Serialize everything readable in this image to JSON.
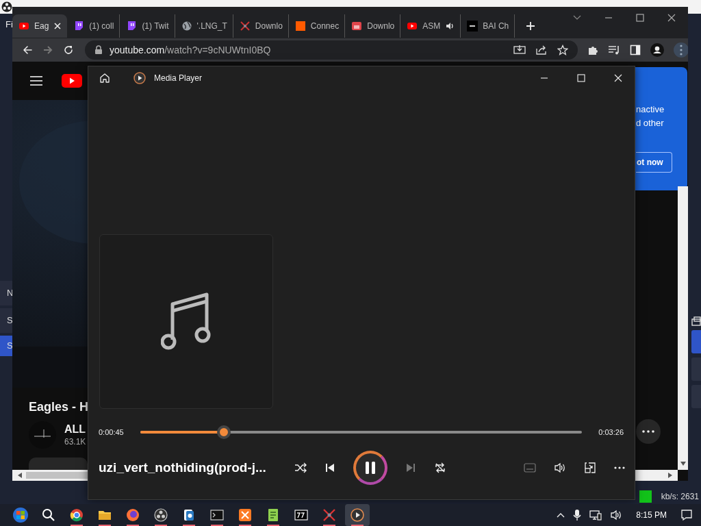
{
  "obs": {
    "menu_text": "Fi",
    "side_texts": [
      "N",
      "S",
      "S"
    ],
    "status_bitrate": "kb/s: 2631"
  },
  "browser": {
    "tabs": [
      {
        "title": "Eag",
        "kind": "youtube",
        "selected": true
      },
      {
        "title": "(1) coll",
        "kind": "twitch",
        "selected": false
      },
      {
        "title": "(1) Twit",
        "kind": "twitch",
        "selected": false
      },
      {
        "title": "'.LNG_T",
        "kind": "globe",
        "selected": false
      },
      {
        "title": "Downlo",
        "kind": "swords",
        "selected": false
      },
      {
        "title": "Connec",
        "kind": "square",
        "selected": false
      },
      {
        "title": "Downlo",
        "kind": "store",
        "selected": false
      },
      {
        "title": "ASM",
        "kind": "youtube",
        "selected": false,
        "audio": true
      },
      {
        "title": "BAI Ch",
        "kind": "bai",
        "selected": false
      }
    ],
    "url_domain": "youtube.com",
    "url_path": "/watch?v=9cNUWtnI0BQ"
  },
  "youtube": {
    "video_title": "Eagles - H",
    "channel": "ALL",
    "subscribers": "63.1K"
  },
  "popup": {
    "lines": [
      "nactive",
      "d other"
    ],
    "button": "ot now"
  },
  "player": {
    "title": "Media Player",
    "elapsed": "0:00:45",
    "total": "0:03:26",
    "level": 0.19,
    "track": "uzi_vert_nothiding(prod-j...",
    "playing": true
  },
  "taskbar": {
    "apps": [
      {
        "kind": "start",
        "running": false,
        "selected": false
      },
      {
        "kind": "search",
        "running": false,
        "selected": false
      },
      {
        "kind": "chrome",
        "running": true,
        "selected": false
      },
      {
        "kind": "folder",
        "running": true,
        "selected": false
      },
      {
        "kind": "firefox",
        "running": true,
        "selected": false
      },
      {
        "kind": "obs",
        "running": true,
        "selected": false
      },
      {
        "kind": "cards",
        "running": true,
        "selected": false
      },
      {
        "kind": "terminal",
        "running": true,
        "selected": false
      },
      {
        "kind": "xampp",
        "running": true,
        "selected": false
      },
      {
        "kind": "notepad",
        "running": true,
        "selected": false
      },
      {
        "kind": "archive",
        "running": false,
        "selected": false
      },
      {
        "kind": "swords",
        "running": true,
        "selected": false
      },
      {
        "kind": "player",
        "running": true,
        "selected": true
      }
    ],
    "time": "8:15 PM"
  }
}
